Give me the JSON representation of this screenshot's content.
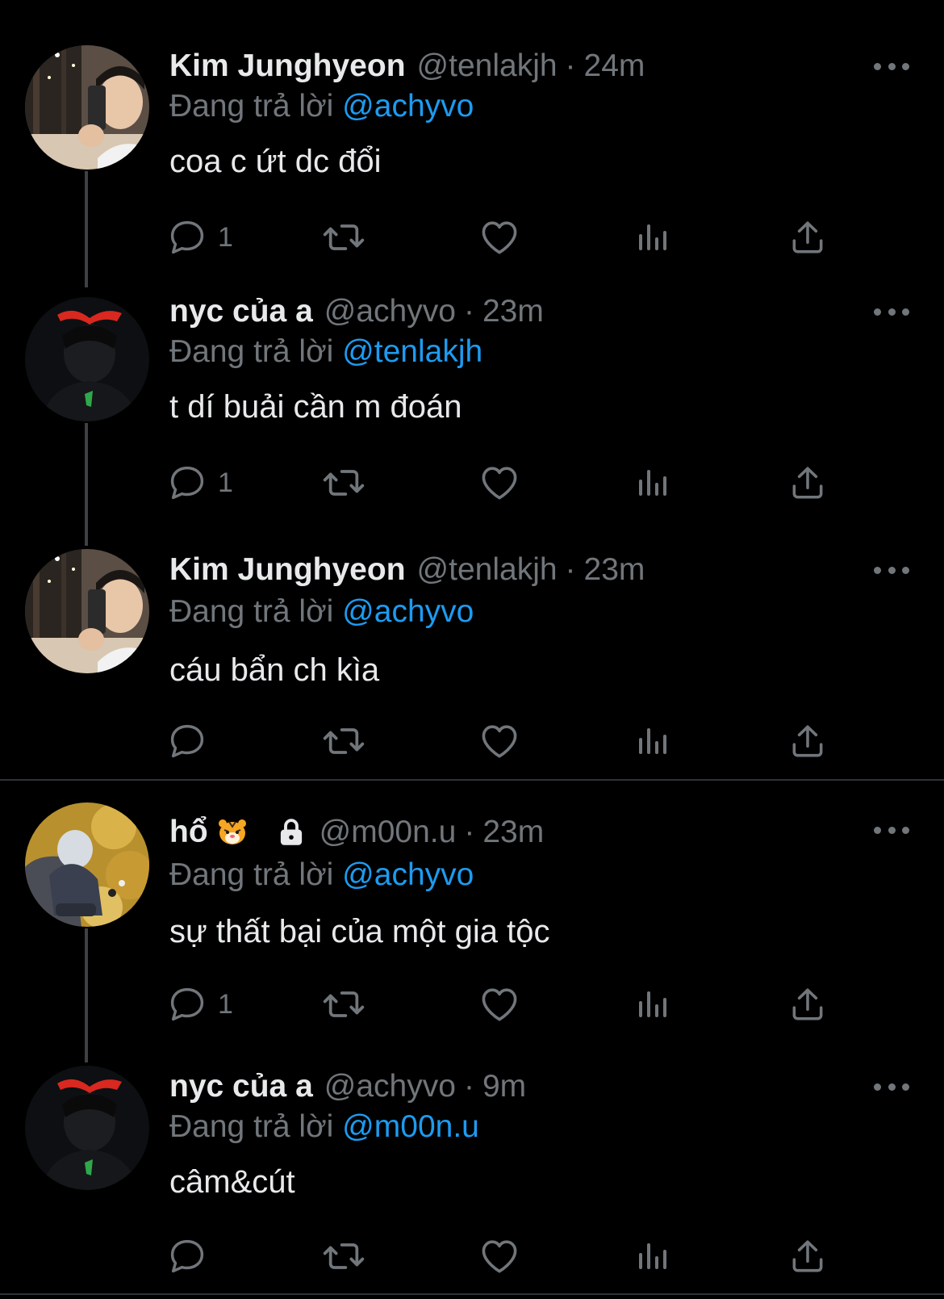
{
  "colors": {
    "background": "#000000",
    "text_primary": "#e7e9ea",
    "text_secondary": "#71767b",
    "mention": "#1d9bf0",
    "thread_line": "#3e4144"
  },
  "icons": {
    "reply": "reply-icon",
    "retweet": "retweet-icon",
    "like": "heart-icon",
    "views": "views-bar-chart-icon",
    "share": "share-upload-icon",
    "more": "more-options-icon",
    "protected": "lock-icon",
    "tiger_emoji": "tiger-face-emoji"
  },
  "tweets": [
    {
      "name": "Kim Junghyeon",
      "handle": "@tenlakjh",
      "separator": "·",
      "time": "24m",
      "replying_prefix": "Đang trả lời",
      "replying_to": "@achyvo",
      "text": "coa c ứt dc đổi",
      "reply_count": "1"
    },
    {
      "name": "nyc của a",
      "handle": "@achyvo",
      "separator": "·",
      "time": "23m",
      "replying_prefix": "Đang trả lời",
      "replying_to": "@tenlakjh",
      "text": "t dí buải cần m đoán",
      "reply_count": "1"
    },
    {
      "name": "Kim Junghyeon",
      "handle": "@tenlakjh",
      "separator": "·",
      "time": "23m",
      "replying_prefix": "Đang trả lời",
      "replying_to": "@achyvo",
      "text": "cáu bẩn ch kìa",
      "reply_count": ""
    },
    {
      "name": "hổ",
      "handle": "@m00n.u",
      "separator": "·",
      "time": "23m",
      "replying_prefix": "Đang trả lời",
      "replying_to": "@achyvo",
      "text": "sự thất bại của một gia tộc",
      "reply_count": "1"
    },
    {
      "name": "nyc của a",
      "handle": "@achyvo",
      "separator": "·",
      "time": "9m",
      "replying_prefix": "Đang trả lời",
      "replying_to": "@m00n.u",
      "text": "câm&cút",
      "reply_count": ""
    }
  ]
}
